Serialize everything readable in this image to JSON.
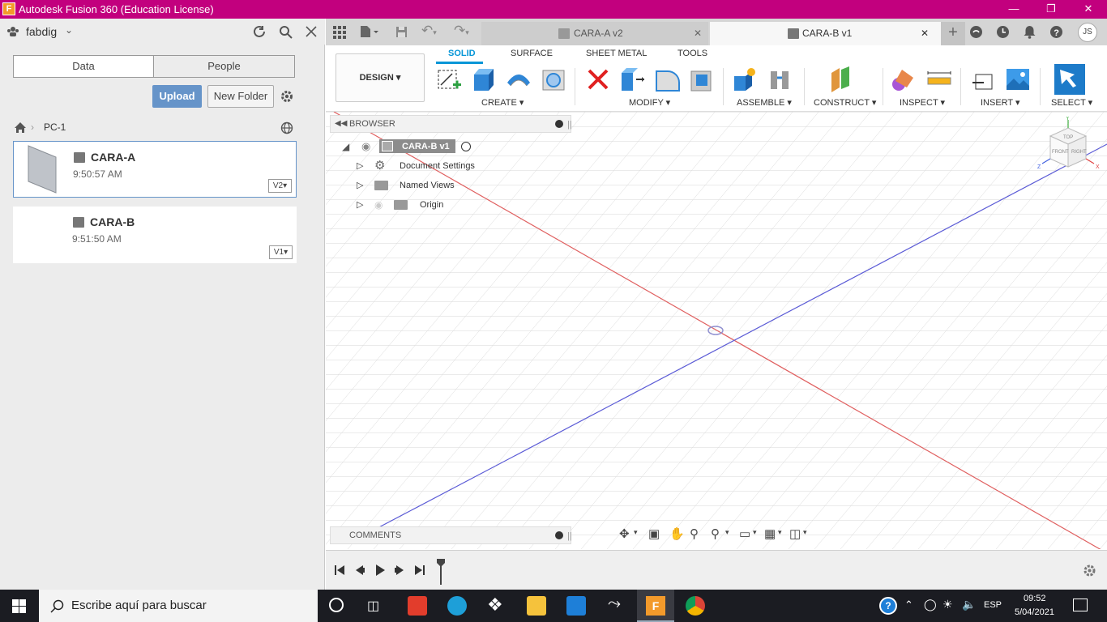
{
  "window": {
    "title": "Autodesk Fusion 360 (Education License)",
    "app_icon": "F"
  },
  "datapanel": {
    "user": "fabdig",
    "tabs": [
      "Data",
      "People"
    ],
    "upload_label": "Upload",
    "new_folder_label": "New Folder",
    "breadcrumb": "PC-1",
    "files": [
      {
        "name": "CARA-A",
        "time": "9:50:57 AM",
        "version": "V2"
      },
      {
        "name": "CARA-B",
        "time": "9:51:50 AM",
        "version": "V1"
      }
    ]
  },
  "doc_tabs": [
    {
      "label": "CARA-A v2",
      "active": false
    },
    {
      "label": "CARA-B v1",
      "active": true
    }
  ],
  "user_initials": "JS",
  "toolbar": {
    "workspace": "DESIGN",
    "tabs": [
      "SOLID",
      "SURFACE",
      "SHEET METAL",
      "TOOLS"
    ],
    "active_tab": "SOLID",
    "groups": [
      "CREATE",
      "MODIFY",
      "ASSEMBLE",
      "CONSTRUCT",
      "INSPECT",
      "INSERT",
      "SELECT"
    ]
  },
  "browser": {
    "title": "BROWSER",
    "root": "CARA-B v1",
    "items": [
      "Document Settings",
      "Named Views",
      "Origin"
    ]
  },
  "comments_label": "COMMENTS",
  "viewcube": {
    "top": "TOP",
    "front": "FRONT",
    "right": "RIGHT",
    "x": "X",
    "y": "Y",
    "z": "Z"
  },
  "taskbar": {
    "search_placeholder": "Escribe aquí para buscar",
    "lang": "ESP",
    "time": "09:52",
    "date": "5/04/2021"
  },
  "colors": {
    "titlebar": "#c2007e",
    "accent": "#0696d7",
    "upload": "#6694c9",
    "red_axis": "#e06060",
    "blue_axis": "#5b5bd6"
  }
}
